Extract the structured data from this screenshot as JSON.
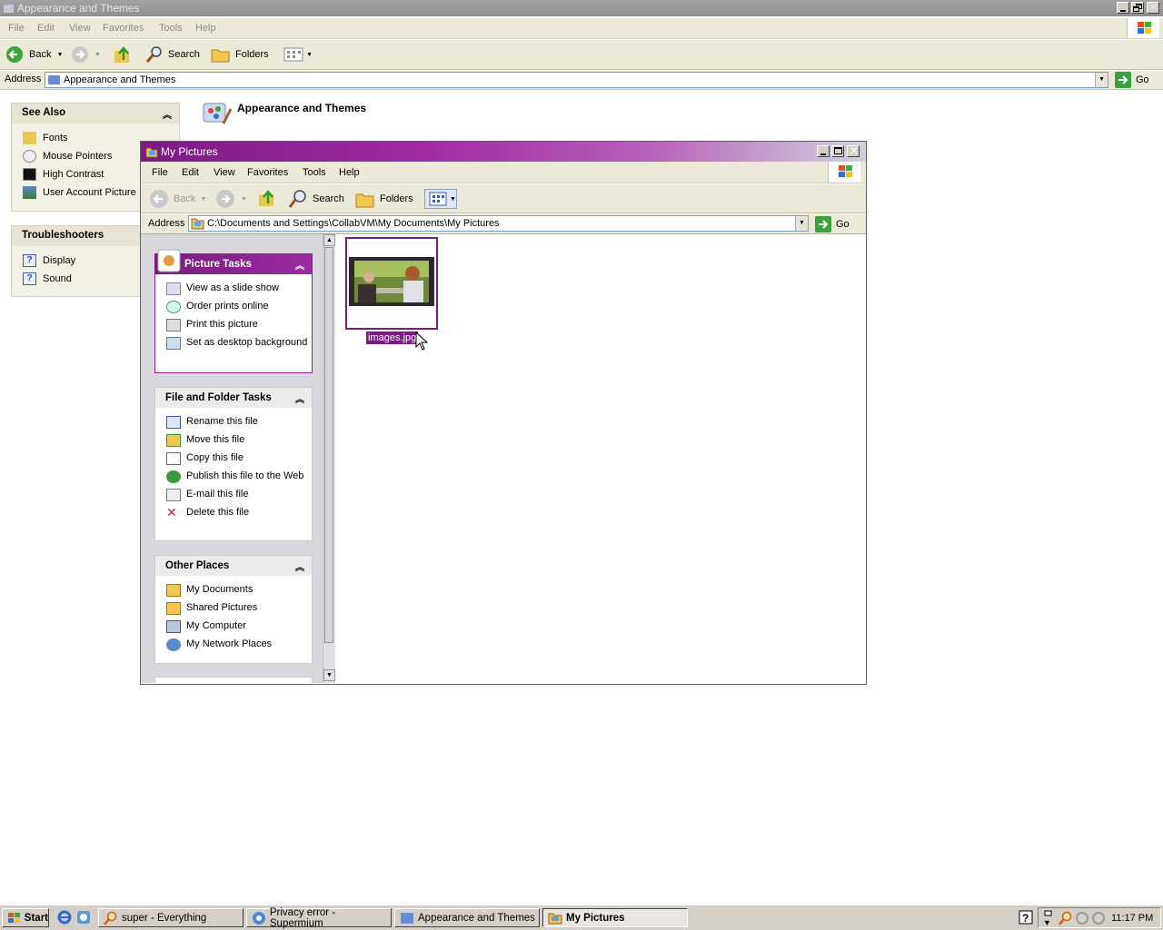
{
  "back_window": {
    "title": "Appearance and Themes",
    "menu": [
      "File",
      "Edit",
      "View",
      "Favorites",
      "Tools",
      "Help"
    ],
    "toolbar": {
      "back": "Back",
      "search": "Search",
      "folders": "Folders"
    },
    "address_label": "Address",
    "address_value": "Appearance and Themes",
    "go": "Go",
    "heading": "Appearance and Themes",
    "see_also": {
      "title": "See Also",
      "items": [
        "Fonts",
        "Mouse Pointers",
        "High Contrast",
        "User Account Picture"
      ]
    },
    "troubleshooters": {
      "title": "Troubleshooters",
      "items": [
        "Display",
        "Sound"
      ]
    }
  },
  "mypictures": {
    "title": "My Pictures",
    "menu": [
      "File",
      "Edit",
      "View",
      "Favorites",
      "Tools",
      "Help"
    ],
    "toolbar": {
      "back": "Back",
      "search": "Search",
      "folders": "Folders"
    },
    "address_label": "Address",
    "address_value": "C:\\Documents and Settings\\CollabVM\\My Documents\\My Pictures",
    "go": "Go",
    "picture_tasks": {
      "title": "Picture Tasks",
      "items": [
        "View as a slide show",
        "Order prints online",
        "Print this picture",
        "Set as desktop background"
      ]
    },
    "file_tasks": {
      "title": "File and Folder Tasks",
      "items": [
        "Rename this file",
        "Move this file",
        "Copy this file",
        "Publish this file to the Web",
        "E-mail this file",
        "Delete this file"
      ]
    },
    "other_places": {
      "title": "Other Places",
      "items": [
        "My Documents",
        "Shared Pictures",
        "My Computer",
        "My Network Places"
      ]
    },
    "file": {
      "name": "images.jpg"
    }
  },
  "taskbar": {
    "start": "Start",
    "buttons": [
      "super - Everything",
      "Privacy error - Supermium",
      "Appearance and Themes",
      "My Pictures"
    ],
    "clock": "11:17 PM"
  }
}
